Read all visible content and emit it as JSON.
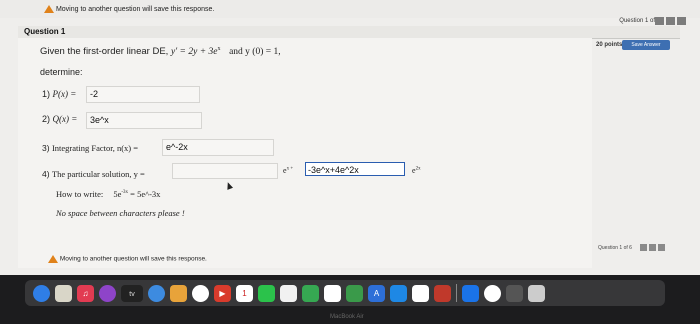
{
  "warning_top": "Moving to another question will save this response.",
  "question_counter_top": "Question 1 of 6",
  "question_label": "Question 1",
  "points": "20 points",
  "save_answer": "Save Answer",
  "prompt_text": "Given the first-order linear DE,",
  "prompt_equation": "y' = 2y + 3e",
  "prompt_exponent": "x",
  "prompt_condition": "and y (0) = 1,",
  "determine_label": "determine:",
  "parts": [
    {
      "num": "1)",
      "label": "P(x) =",
      "value": "-2"
    },
    {
      "num": "2)",
      "label": "Q(x) =",
      "value": "3e^x"
    },
    {
      "num": "3)",
      "label": "Integrating Factor, n(x) =",
      "value": "e^-2x"
    },
    {
      "num": "4)",
      "label": "The particular solution, y =",
      "value": ""
    }
  ],
  "solution_term_before": "e",
  "solution_term_before_exp": "x +",
  "solution_box_value": "-3e^x+4e^2x",
  "solution_term_after": "e",
  "solution_term_after_exp": "2x",
  "how_to_write_label": "How to write:",
  "how_to_write_example": "5e",
  "how_to_write_example_exp": "-3x",
  "how_to_write_equals": "= 5e^-3x",
  "no_space_note": "No space between characters please !",
  "warning_bottom": "Moving to another question will save this response.",
  "question_counter_bottom": "Question 1 of 6",
  "dock": {
    "apple_tv_label": "tv",
    "calendar_day": "1"
  },
  "bottom_label": "MacBook Air"
}
